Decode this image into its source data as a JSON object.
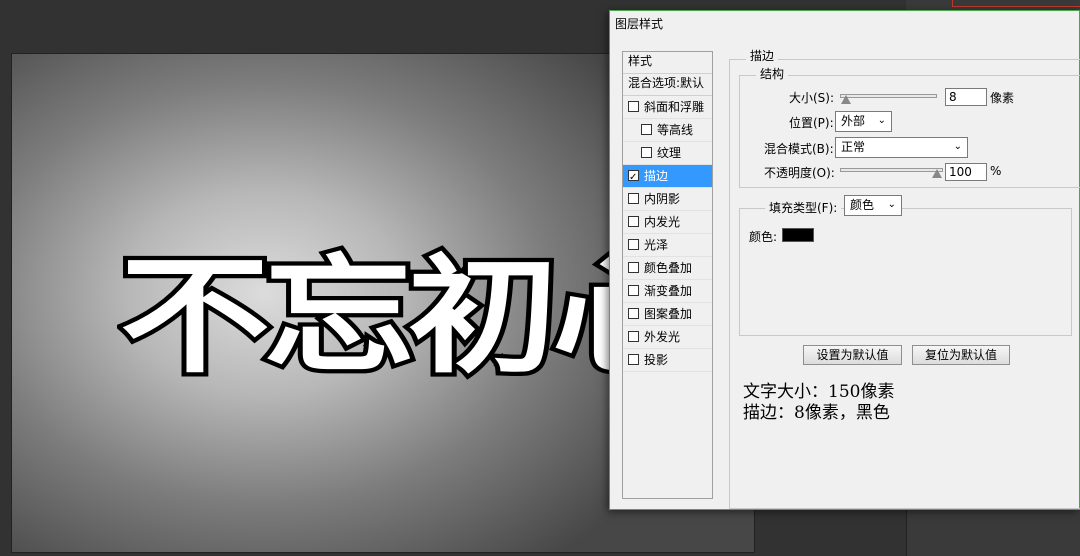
{
  "canvas": {
    "text": "不忘初心",
    "text_color": "#ffffff",
    "stroke_color": "#000000"
  },
  "dialog": {
    "title": "图层样式",
    "style_list": {
      "header": "样式",
      "blend_options": "混合选项:默认",
      "items": [
        {
          "label": "斜面和浮雕",
          "checked": false,
          "sub": false,
          "selected": false
        },
        {
          "label": "等高线",
          "checked": false,
          "sub": true,
          "selected": false
        },
        {
          "label": "纹理",
          "checked": false,
          "sub": true,
          "selected": false
        },
        {
          "label": "描边",
          "checked": true,
          "sub": false,
          "selected": true
        },
        {
          "label": "内阴影",
          "checked": false,
          "sub": false,
          "selected": false
        },
        {
          "label": "内发光",
          "checked": false,
          "sub": false,
          "selected": false
        },
        {
          "label": "光泽",
          "checked": false,
          "sub": false,
          "selected": false
        },
        {
          "label": "颜色叠加",
          "checked": false,
          "sub": false,
          "selected": false
        },
        {
          "label": "渐变叠加",
          "checked": false,
          "sub": false,
          "selected": false
        },
        {
          "label": "图案叠加",
          "checked": false,
          "sub": false,
          "selected": false
        },
        {
          "label": "外发光",
          "checked": false,
          "sub": false,
          "selected": false
        },
        {
          "label": "投影",
          "checked": false,
          "sub": false,
          "selected": false
        }
      ]
    },
    "stroke": {
      "title": "描边",
      "structure_title": "结构",
      "size_label": "大小(S):",
      "size_value": "8",
      "size_unit": "像素",
      "position_label": "位置(P):",
      "position_value": "外部",
      "blend_mode_label": "混合模式(B):",
      "blend_mode_value": "正常",
      "opacity_label": "不透明度(O):",
      "opacity_value": "100",
      "opacity_unit": "%",
      "fill_type_label": "填充类型(F):",
      "fill_type_value": "颜色",
      "color_label": "颜色:",
      "color_value": "#000000"
    },
    "buttons": {
      "make_default": "设置为默认值",
      "reset_default": "复位为默认值"
    },
    "annotation": {
      "line1": "文字大小：150像素",
      "line2": "描边：8像素，黑色"
    }
  }
}
